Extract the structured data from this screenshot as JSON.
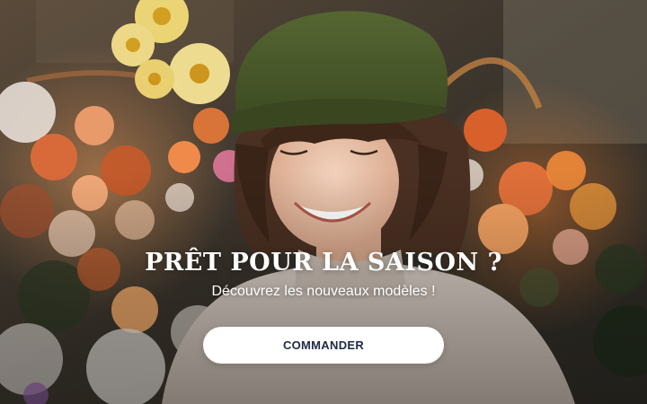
{
  "banner": {
    "headline": "PRÊT POUR LA SAISON ?",
    "subheadline": "Découvrez les nouveaux modèles !",
    "cta_label": "COMMANDER"
  },
  "photo": {
    "subject": "smiling-woman-green-flat-cap",
    "background": "flower-bouquets"
  },
  "colors": {
    "cta_background": "#ffffff",
    "cta_text": "#1f2a44",
    "headline_text": "#ffffff",
    "cap": "#4a5a2a"
  }
}
